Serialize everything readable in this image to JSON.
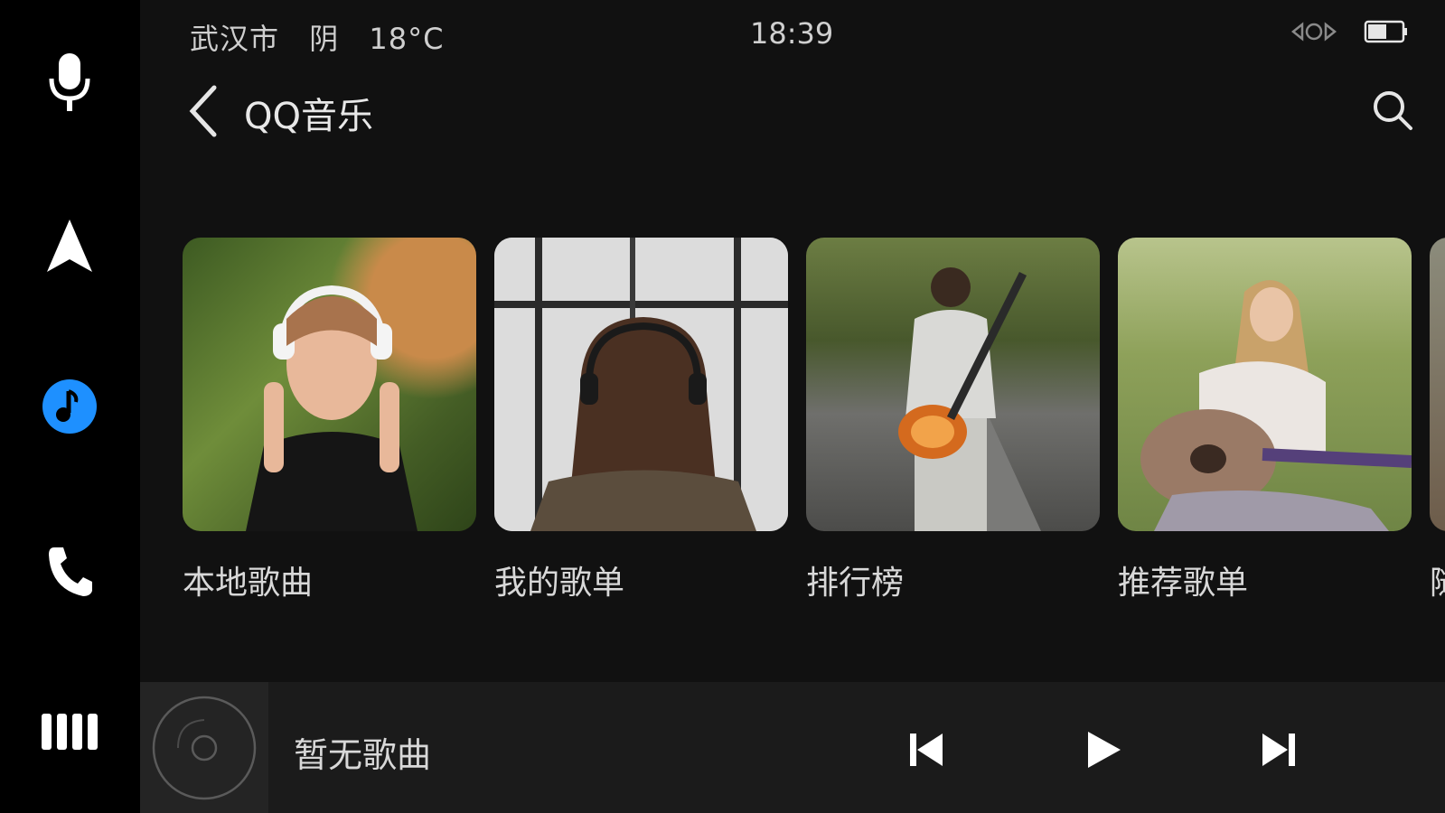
{
  "status": {
    "city": "武汉市",
    "weather": "阴",
    "temperature": "18°C",
    "time": "18:39",
    "icons": [
      "link-icon",
      "battery-icon"
    ]
  },
  "header": {
    "title": "QQ音乐",
    "back_icon": "back-chevron-icon",
    "search_icon": "search-icon"
  },
  "dock": {
    "items": [
      {
        "icon": "microphone-icon"
      },
      {
        "icon": "navigation-arrow-icon"
      },
      {
        "icon": "music-icon",
        "active": true,
        "color": "#1e90ff"
      },
      {
        "icon": "phone-icon"
      },
      {
        "icon": "apps-grid-icon"
      }
    ]
  },
  "categories": [
    {
      "label": "本地歌曲",
      "image": "woman-with-headphones"
    },
    {
      "label": "我的歌单",
      "image": "girl-headphones-window"
    },
    {
      "label": "排行榜",
      "image": "man-with-guitar-road"
    },
    {
      "label": "推荐歌单",
      "image": "woman-playing-guitar"
    },
    {
      "label": "随",
      "image": "partial-card"
    }
  ],
  "player": {
    "song": "暂无歌曲",
    "controls": [
      "previous-icon",
      "play-icon",
      "next-icon"
    ]
  },
  "colors": {
    "accent": "#1e90ff",
    "panel": "#111111",
    "dock": "#000000",
    "player": "#1b1b1b"
  }
}
